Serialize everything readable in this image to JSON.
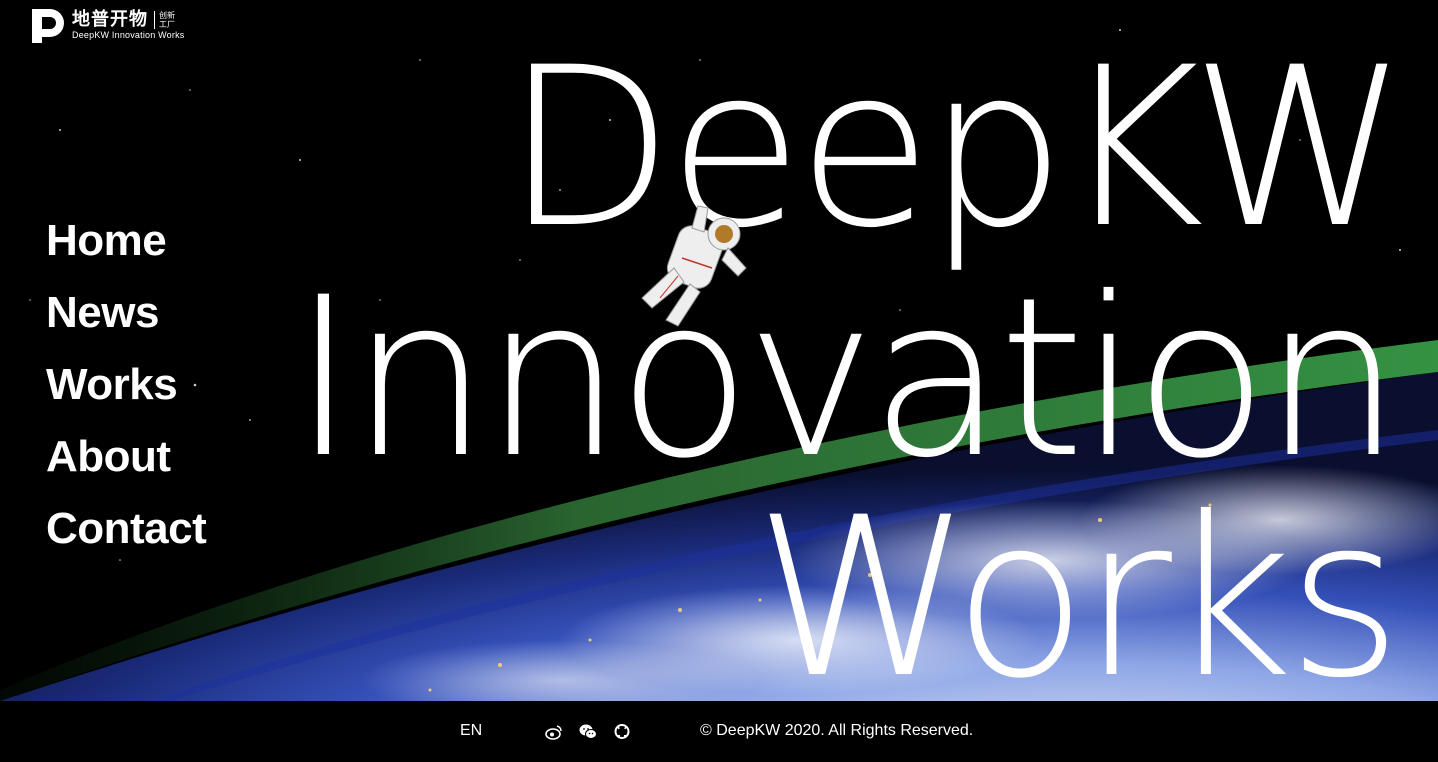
{
  "logo": {
    "cn": "地普开物",
    "sub_cn": "创新工厂",
    "en": "DeepKW Innovation Works"
  },
  "nav": {
    "items": [
      {
        "label": "Home"
      },
      {
        "label": "News"
      },
      {
        "label": "Works"
      },
      {
        "label": "About"
      },
      {
        "label": "Contact"
      }
    ]
  },
  "hero": {
    "line1": "DeepKW",
    "line2": "Innovation",
    "line3": "Works"
  },
  "footer": {
    "language": "EN",
    "social_icons": [
      "weibo-icon",
      "wechat-icon",
      "github-icon"
    ],
    "copyright": "© DeepKW 2020. All Rights Reserved."
  },
  "colors": {
    "background": "#000000",
    "text": "#ffffff",
    "earth_blue": "#3a5fd0",
    "atmosphere_green": "#2f7a3a"
  }
}
